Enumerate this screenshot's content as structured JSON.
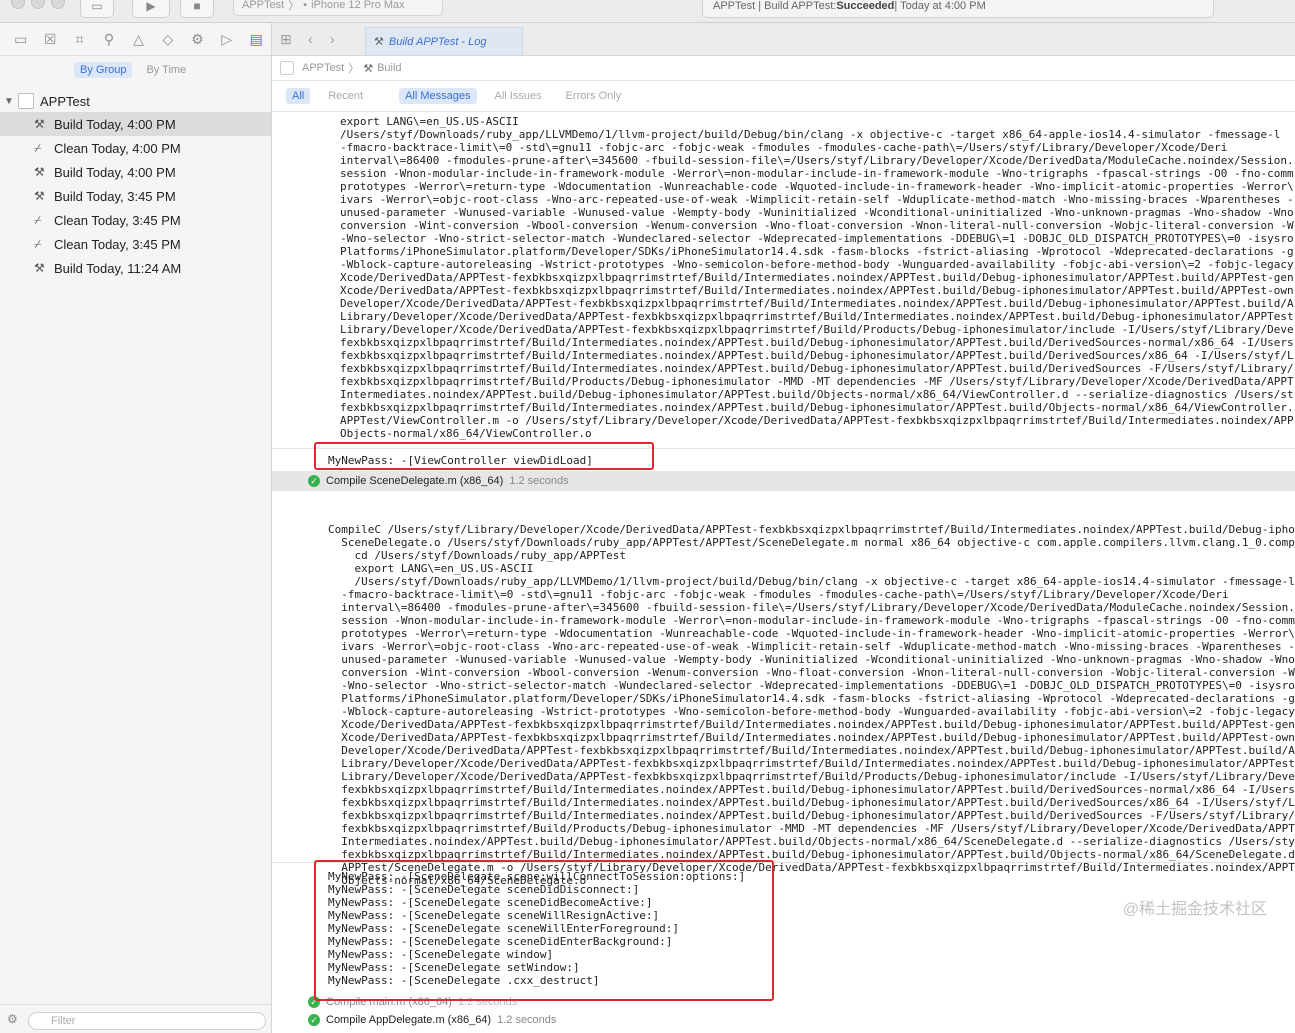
{
  "titlebar": {
    "scheme_project": "APPTest",
    "scheme_device": "iPhone 12 Pro Max",
    "status_prefix": "APPTest | Build APPTest: ",
    "status_result": "Succeeded",
    "status_suffix": " | Today at 4:00 PM"
  },
  "navigator": {
    "segments": {
      "by_group": "By Group",
      "by_time": "By Time"
    },
    "project": "APPTest",
    "logs": [
      {
        "kind": "Build",
        "label": "Build Today, 4:00 PM",
        "selected": true
      },
      {
        "kind": "Clean",
        "label": "Clean Today, 4:00 PM",
        "selected": false
      },
      {
        "kind": "Build",
        "label": "Build Today, 4:00 PM",
        "selected": false
      },
      {
        "kind": "Build",
        "label": "Build Today, 3:45 PM",
        "selected": false
      },
      {
        "kind": "Clean",
        "label": "Clean Today, 3:45 PM",
        "selected": false
      },
      {
        "kind": "Clean",
        "label": "Clean Today, 3:45 PM",
        "selected": false
      },
      {
        "kind": "Build",
        "label": "Build Today, 11:24 AM",
        "selected": false
      }
    ],
    "filter_placeholder": "Filter"
  },
  "editor": {
    "tab_title": "Build APPTest - Log",
    "jumpbar": {
      "project": "APPTest",
      "item": "Build"
    },
    "filters": {
      "all": "All",
      "recent": "Recent",
      "all_messages": "All Messages",
      "all_issues": "All Issues",
      "errors_only": "Errors Only"
    },
    "log_block_1": "export LANG\\=en_US.US-ASCII\n/Users/styf/Downloads/ruby_app/LLVMDemo/1/llvm-project/build/Debug/bin/clang -x objective-c -target x86_64-apple-ios14.4-simulator -fmessage-l\n-fmacro-backtrace-limit\\=0 -std\\=gnu11 -fobjc-arc -fobjc-weak -fmodules -fmodules-cache-path\\=/Users/styf/Library/Developer/Xcode/Deri\ninterval\\=86400 -fmodules-prune-after\\=345600 -fbuild-session-file\\=/Users/styf/Library/Developer/Xcode/DerivedData/ModuleCache.noindex/Session.\nsession -Wnon-modular-include-in-framework-module -Werror\\=non-modular-include-in-framework-module -Wno-trigraphs -fpascal-strings -O0 -fno-comm\nprototypes -Werror\\=return-type -Wdocumentation -Wunreachable-code -Wquoted-include-in-framework-header -Wno-implicit-atomic-properties -Werror\\\nivars -Werror\\=objc-root-class -Wno-arc-repeated-use-of-weak -Wimplicit-retain-self -Wduplicate-method-match -Wno-missing-braces -Wparentheses -\nunused-parameter -Wunused-variable -Wunused-value -Wempty-body -Wuninitialized -Wconditional-uninitialized -Wno-unknown-pragmas -Wno-shadow -Wno-\nconversion -Wint-conversion -Wbool-conversion -Wenum-conversion -Wno-float-conversion -Wnon-literal-null-conversion -Wobjc-literal-conversion -W\n-Wno-selector -Wno-strict-selector-match -Wundeclared-selector -Wdeprecated-implementations -DDEBUG\\=1 -DOBJC_OLD_DISPATCH_PROTOTYPES\\=0 -isysro\nPlatforms/iPhoneSimulator.platform/Developer/SDKs/iPhoneSimulator14.4.sdk -fasm-blocks -fstrict-aliasing -Wprotocol -Wdeprecated-declarations -g\n-Wblock-capture-autoreleasing -Wstrict-prototypes -Wno-semicolon-before-method-body -Wunguarded-availability -fobjc-abi-version\\=2 -fobjc-legacy\nXcode/DerivedData/APPTest-fexbkbsxqizpxlbpaqrrimstrtef/Build/Intermediates.noindex/APPTest.build/Debug-iphonesimulator/APPTest.build/APPTest-gen\nXcode/DerivedData/APPTest-fexbkbsxqizpxlbpaqrrimstrtef/Build/Intermediates.noindex/APPTest.build/Debug-iphonesimulator/APPTest.build/APPTest-own\nDeveloper/Xcode/DerivedData/APPTest-fexbkbsxqizpxlbpaqrrimstrtef/Build/Intermediates.noindex/APPTest.build/Debug-iphonesimulator/APPTest.build/A\nLibrary/Developer/Xcode/DerivedData/APPTest-fexbkbsxqizpxlbpaqrrimstrtef/Build/Intermediates.noindex/APPTest.build/Debug-iphonesimulator/APPTest\nLibrary/Developer/Xcode/DerivedData/APPTest-fexbkbsxqizpxlbpaqrrimstrtef/Build/Products/Debug-iphonesimulator/include -I/Users/styf/Library/Deve\nfexbkbsxqizpxlbpaqrrimstrtef/Build/Intermediates.noindex/APPTest.build/Debug-iphonesimulator/APPTest.build/DerivedSources-normal/x86_64 -I/Users\nfexbkbsxqizpxlbpaqrrimstrtef/Build/Intermediates.noindex/APPTest.build/Debug-iphonesimulator/APPTest.build/DerivedSources/x86_64 -I/Users/styf/L\nfexbkbsxqizpxlbpaqrrimstrtef/Build/Intermediates.noindex/APPTest.build/Debug-iphonesimulator/APPTest.build/DerivedSources -F/Users/styf/Library/\nfexbkbsxqizpxlbpaqrrimstrtef/Build/Products/Debug-iphonesimulator -MMD -MT dependencies -MF /Users/styf/Library/Developer/Xcode/DerivedData/APPT\nIntermediates.noindex/APPTest.build/Debug-iphonesimulator/APPTest.build/Objects-normal/x86_64/ViewController.d --serialize-diagnostics /Users/st\nfexbkbsxqizpxlbpaqrrimstrtef/Build/Intermediates.noindex/APPTest.build/Debug-iphonesimulator/APPTest.build/Objects-normal/x86_64/ViewController.\nAPPTest/ViewController.m -o /Users/styf/Library/Developer/Xcode/DerivedData/APPTest-fexbkbsxqizpxlbpaqrrimstrtef/Build/Intermediates.noindex/APP\nObjects-normal/x86_64/ViewController.o",
    "pass_output_1": "MyNewPass: -[ViewController viewDidLoad]",
    "step_1": {
      "label": "Compile SceneDelegate.m (x86_64)",
      "duration": "1.2 seconds"
    },
    "log_block_2": "CompileC /Users/styf/Library/Developer/Xcode/DerivedData/APPTest-fexbkbsxqizpxlbpaqrrimstrtef/Build/Intermediates.noindex/APPTest.build/Debug-ipho\n  SceneDelegate.o /Users/styf/Downloads/ruby_app/APPTest/APPTest/SceneDelegate.m normal x86_64 objective-c com.apple.compilers.llvm.clang.1_0.comp\n    cd /Users/styf/Downloads/ruby_app/APPTest\n    export LANG\\=en_US.US-ASCII\n    /Users/styf/Downloads/ruby_app/LLVMDemo/1/llvm-project/build/Debug/bin/clang -x objective-c -target x86_64-apple-ios14.4-simulator -fmessage-l\n  -fmacro-backtrace-limit\\=0 -std\\=gnu11 -fobjc-arc -fobjc-weak -fmodules -fmodules-cache-path\\=/Users/styf/Library/Developer/Xcode/Deri\n  interval\\=86400 -fmodules-prune-after\\=345600 -fbuild-session-file\\=/Users/styf/Library/Developer/Xcode/DerivedData/ModuleCache.noindex/Session.\n  session -Wnon-modular-include-in-framework-module -Werror\\=non-modular-include-in-framework-module -Wno-trigraphs -fpascal-strings -O0 -fno-comm\n  prototypes -Werror\\=return-type -Wdocumentation -Wunreachable-code -Wquoted-include-in-framework-header -Wno-implicit-atomic-properties -Werror\\\n  ivars -Werror\\=objc-root-class -Wno-arc-repeated-use-of-weak -Wimplicit-retain-self -Wduplicate-method-match -Wno-missing-braces -Wparentheses -\n  unused-parameter -Wunused-variable -Wunused-value -Wempty-body -Wuninitialized -Wconditional-uninitialized -Wno-unknown-pragmas -Wno-shadow -Wno-\n  conversion -Wint-conversion -Wbool-conversion -Wenum-conversion -Wno-float-conversion -Wnon-literal-null-conversion -Wobjc-literal-conversion -W\n  -Wno-selector -Wno-strict-selector-match -Wundeclared-selector -Wdeprecated-implementations -DDEBUG\\=1 -DOBJC_OLD_DISPATCH_PROTOTYPES\\=0 -isysro\n  Platforms/iPhoneSimulator.platform/Developer/SDKs/iPhoneSimulator14.4.sdk -fasm-blocks -fstrict-aliasing -Wprotocol -Wdeprecated-declarations -g\n  -Wblock-capture-autoreleasing -Wstrict-prototypes -Wno-semicolon-before-method-body -Wunguarded-availability -fobjc-abi-version\\=2 -fobjc-legacy\n  Xcode/DerivedData/APPTest-fexbkbsxqizpxlbpaqrrimstrtef/Build/Intermediates.noindex/APPTest.build/Debug-iphonesimulator/APPTest.build/APPTest-gen\n  Xcode/DerivedData/APPTest-fexbkbsxqizpxlbpaqrrimstrtef/Build/Intermediates.noindex/APPTest.build/Debug-iphonesimulator/APPTest.build/APPTest-own\n  Developer/Xcode/DerivedData/APPTest-fexbkbsxqizpxlbpaqrrimstrtef/Build/Intermediates.noindex/APPTest.build/Debug-iphonesimulator/APPTest.build/A\n  Library/Developer/Xcode/DerivedData/APPTest-fexbkbsxqizpxlbpaqrrimstrtef/Build/Intermediates.noindex/APPTest.build/Debug-iphonesimulator/APPTest\n  Library/Developer/Xcode/DerivedData/APPTest-fexbkbsxqizpxlbpaqrrimstrtef/Build/Products/Debug-iphonesimulator/include -I/Users/styf/Library/Deve\n  fexbkbsxqizpxlbpaqrrimstrtef/Build/Intermediates.noindex/APPTest.build/Debug-iphonesimulator/APPTest.build/DerivedSources-normal/x86_64 -I/Users\n  fexbkbsxqizpxlbpaqrrimstrtef/Build/Intermediates.noindex/APPTest.build/Debug-iphonesimulator/APPTest.build/DerivedSources/x86_64 -I/Users/styf/L\n  fexbkbsxqizpxlbpaqrrimstrtef/Build/Intermediates.noindex/APPTest.build/Debug-iphonesimulator/APPTest.build/DerivedSources -F/Users/styf/Library/\n  fexbkbsxqizpxlbpaqrrimstrtef/Build/Products/Debug-iphonesimulator -MMD -MT dependencies -MF /Users/styf/Library/Developer/Xcode/DerivedData/APPT\n  Intermediates.noindex/APPTest.build/Debug-iphonesimulator/APPTest.build/Objects-normal/x86_64/SceneDelegate.d --serialize-diagnostics /Users/sty\n  fexbkbsxqizpxlbpaqrrimstrtef/Build/Intermediates.noindex/APPTest.build/Debug-iphonesimulator/APPTest.build/Objects-normal/x86_64/SceneDelegate.d\n  APPTest/SceneDelegate.m -o /Users/styf/Library/Developer/Xcode/DerivedData/APPTest-fexbkbsxqizpxlbpaqrrimstrtef/Build/Intermediates.noindex/APPT\n  Objects-normal/x86_64/SceneDelegate.o",
    "pass_output_2": "MyNewPass: -[SceneDelegate scene:willConnectToSession:options:]\nMyNewPass: -[SceneDelegate sceneDidDisconnect:]\nMyNewPass: -[SceneDelegate sceneDidBecomeActive:]\nMyNewPass: -[SceneDelegate sceneWillResignActive:]\nMyNewPass: -[SceneDelegate sceneWillEnterForeground:]\nMyNewPass: -[SceneDelegate sceneDidEnterBackground:]\nMyNewPass: -[SceneDelegate window]\nMyNewPass: -[SceneDelegate setWindow:]\nMyNewPass: -[SceneDelegate .cxx_destruct]",
    "step_2": {
      "label": "Compile main.m (x86_64)",
      "duration": "1.2 seconds"
    },
    "step_3": {
      "label": "Compile AppDelegate.m (x86_64)",
      "duration": "1.2 seconds"
    }
  },
  "watermark": "@稀土掘金技术社区",
  "colors": {
    "accent": "#3b6fd0",
    "highlight": "#e0262e",
    "success": "#37b24d"
  }
}
